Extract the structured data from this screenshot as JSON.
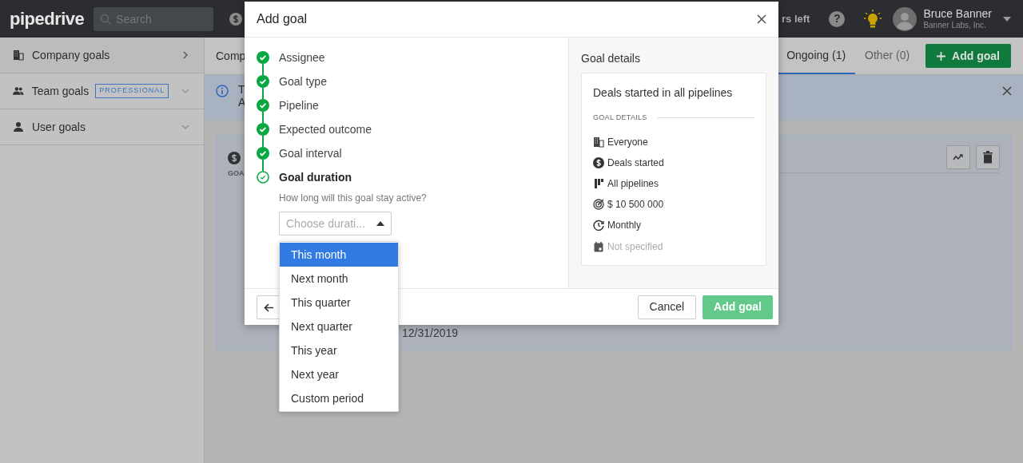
{
  "topbar": {
    "logo": "pipedrive",
    "search": {
      "placeholder": "Search"
    },
    "trial_text": "rs left",
    "help": "?",
    "user": {
      "name": "Bruce Banner",
      "company": "Banner Labs, Inc."
    }
  },
  "sidebar": {
    "items": [
      {
        "label": "Company goals",
        "kind": "building",
        "selected": true
      },
      {
        "label": "Team goals",
        "kind": "team",
        "badge": "PROFESSIONAL",
        "selected": false
      },
      {
        "label": "User goals",
        "kind": "user",
        "selected": false
      }
    ]
  },
  "header": {
    "title": "Comp",
    "tabs": [
      {
        "label": "Ongoing (1)",
        "selected": true
      },
      {
        "label": "Other (0)",
        "selected": false
      }
    ],
    "add_button": "Add goal"
  },
  "banner": {
    "line_1": "T",
    "line_2": "A"
  },
  "goal_card": {
    "section_label": "GOA",
    "date": "12/31/2019"
  },
  "modal": {
    "title": "Add goal",
    "steps": [
      {
        "label": "Assignee",
        "completed": true,
        "selected": false
      },
      {
        "label": "Goal type",
        "completed": true,
        "selected": false
      },
      {
        "label": "Pipeline",
        "completed": true,
        "selected": false
      },
      {
        "label": "Expected outcome",
        "completed": true,
        "selected": false
      },
      {
        "label": "Goal interval",
        "completed": true,
        "selected": false
      },
      {
        "label": "Goal duration",
        "completed": false,
        "selected": true
      }
    ],
    "question": "How long will this goal stay active?",
    "select": {
      "placeholder": "Choose durati...",
      "expanded": true
    },
    "options": [
      {
        "label": "This month",
        "selected": true
      },
      {
        "label": "Next month",
        "selected": false
      },
      {
        "label": "This quarter",
        "selected": false
      },
      {
        "label": "Next quarter",
        "selected": false
      },
      {
        "label": "This year",
        "selected": false
      },
      {
        "label": "Next year",
        "selected": false
      },
      {
        "label": "Custom period",
        "selected": false
      }
    ],
    "details": {
      "heading": "Goal details",
      "title": "Deals started in all pipelines",
      "section": "GOAL DETAILS",
      "items": [
        {
          "kind": "building",
          "text": "Everyone",
          "muted": false
        },
        {
          "kind": "dollar",
          "text": "Deals started",
          "muted": false
        },
        {
          "kind": "pipeline",
          "text": "All pipelines",
          "muted": false
        },
        {
          "kind": "target",
          "text": "$ 10 500 000",
          "muted": false
        },
        {
          "kind": "clock",
          "text": "Monthly",
          "muted": false
        },
        {
          "kind": "calendar",
          "text": "Not specified",
          "muted": true
        }
      ]
    },
    "buttons": {
      "cancel": "Cancel",
      "submit": "Add goal",
      "submit_disabled": true
    }
  }
}
